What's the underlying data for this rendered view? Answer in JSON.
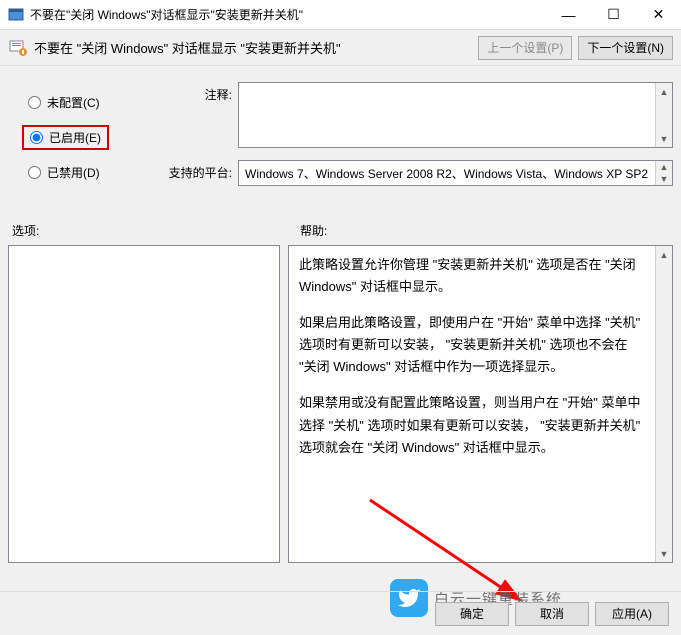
{
  "window": {
    "title": "不要在\"关闭 Windows\"对话框显示\"安装更新并关机\"",
    "minimize": "—",
    "maximize": "☐",
    "close": "✕"
  },
  "header": {
    "text": "不要在 \"关闭 Windows\" 对话框显示 \"安装更新并关机\"",
    "prev": "上一个设置(P)",
    "next": "下一个设置(N)"
  },
  "radio": {
    "unconfigured": "未配置(C)",
    "enabled": "已启用(E)",
    "disabled": "已禁用(D)"
  },
  "labels": {
    "comment": "注释:",
    "platform": "支持的平台:",
    "options": "选项:",
    "help": "帮助:"
  },
  "platform_text": "Windows 7、Windows Server 2008 R2、Windows Vista、Windows XP SP2",
  "help": {
    "p1": "此策略设置允许你管理 \"安装更新并关机\" 选项是否在 \"关闭 Windows\" 对话框中显示。",
    "p2": "如果启用此策略设置，即使用户在 \"开始\" 菜单中选择 \"关机\" 选项时有更新可以安装， \"安装更新并关机\" 选项也不会在 \"关闭 Windows\" 对话框中作为一项选择显示。",
    "p3": "如果禁用或没有配置此策略设置，则当用户在 \"开始\" 菜单中选择 \"关机\" 选项时如果有更新可以安装， \"安装更新并关机\" 选项就会在 \"关闭 Windows\" 对话框中显示。"
  },
  "buttons": {
    "ok": "确定",
    "cancel": "取消",
    "apply": "应用(A)"
  },
  "watermark": "白云一键重装系统"
}
